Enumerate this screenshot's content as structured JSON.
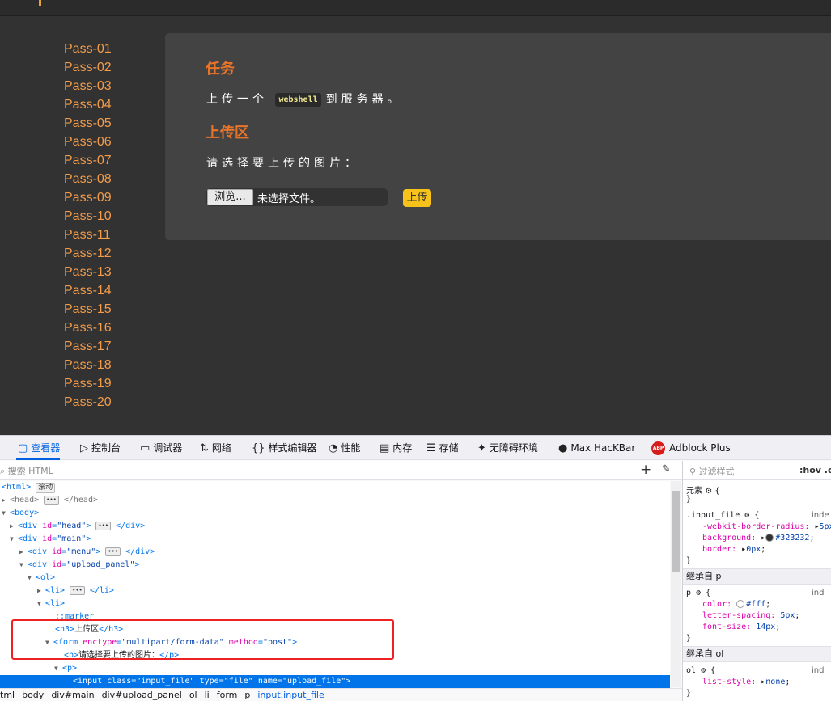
{
  "menu": {
    "items": [
      "Pass-01",
      "Pass-02",
      "Pass-03",
      "Pass-04",
      "Pass-05",
      "Pass-06",
      "Pass-07",
      "Pass-08",
      "Pass-09",
      "Pass-10",
      "Pass-11",
      "Pass-12",
      "Pass-13",
      "Pass-14",
      "Pass-15",
      "Pass-16",
      "Pass-17",
      "Pass-18",
      "Pass-19",
      "Pass-20"
    ]
  },
  "panel": {
    "task_title": "任务",
    "task_text_before": "上传一个",
    "task_code": "webshell",
    "task_text_after": "到服务器。",
    "upload_title": "上传区",
    "select_prompt": "请选择要上传的图片：",
    "browse_label": "浏览...",
    "file_status": "未选择文件。",
    "upload_label": "上传"
  },
  "devtools": {
    "tabs": [
      {
        "icon": "▢",
        "label": "查看器"
      },
      {
        "icon": "▷",
        "label": "控制台"
      },
      {
        "icon": "▭",
        "label": "调试器"
      },
      {
        "icon": "⇅",
        "label": "网络"
      },
      {
        "icon": "{}",
        "label": "样式编辑器"
      },
      {
        "icon": "◔",
        "label": "性能"
      },
      {
        "icon": "▤",
        "label": "内存"
      },
      {
        "icon": "☰",
        "label": "存储"
      },
      {
        "icon": "✦",
        "label": "无障碍环境"
      },
      {
        "icon": "●",
        "label": "Max HacKBar"
      },
      {
        "icon": "ABP",
        "label": "Adblock Plus"
      }
    ],
    "search_placeholder": "搜索 HTML",
    "tree": {
      "html_badge": "滚动",
      "marker": "::marker",
      "h3_text": "上传区",
      "form_enctype": "\"multipart/form-data\"",
      "form_method": "\"post\"",
      "p_text": "请选择要上传的图片：",
      "div_head": "\"head\"",
      "div_main": "\"main\"",
      "div_menu": "\"menu\"",
      "div_upload": "\"upload_panel\"",
      "input_class": "\"input_file\"",
      "input_type": "\"file\"",
      "input_name": "\"upload_file\""
    },
    "breadcrumbs": [
      "tml",
      "body",
      "div#main",
      "div#upload_panel",
      "ol",
      "li",
      "form",
      "p",
      "input.input_file"
    ],
    "rules": {
      "filter_placeholder": "过滤样式",
      "hov": ":hov  .c",
      "element_label": "元素",
      "input_file_selector": ".input_file",
      "input_file_source": "inde",
      "radius_prop": "-webkit-border-radius:",
      "radius_val": "5px",
      "bg_prop": "background:",
      "bg_val": "#323232",
      "bg_color": "#323232",
      "border_prop": "border:",
      "border_val": "0px",
      "inherit_p": "继承自 p",
      "p_selector": "p",
      "p_source": "ind",
      "color_prop": "color:",
      "color_val": "#fff",
      "ls_prop": "letter-spacing:",
      "ls_val": "5px",
      "fs_prop": "font-size:",
      "fs_val": "14px",
      "inherit_ol": "继承自 ol",
      "ol_selector": "ol",
      "ol_source": "ind",
      "liststyle_prop": "list-style:",
      "liststyle_val": "none"
    }
  }
}
